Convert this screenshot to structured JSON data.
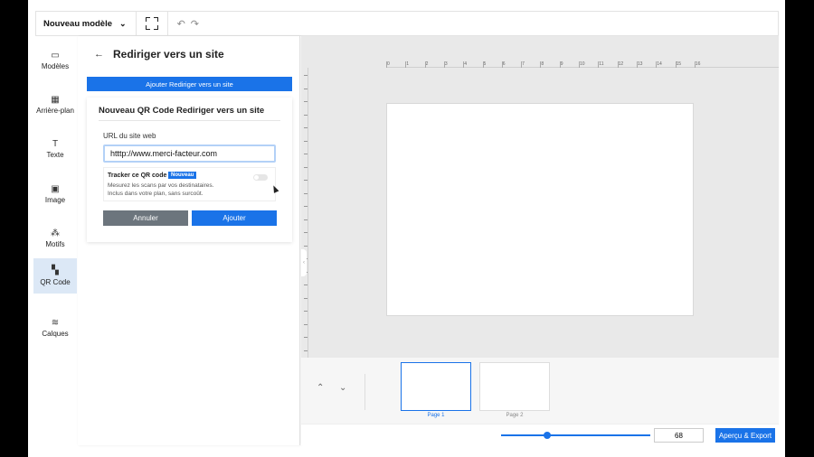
{
  "toolbar": {
    "model_label": "Nouveau modèle"
  },
  "sidebar": {
    "items": [
      {
        "key": "modeles",
        "label": "Modèles",
        "icon": "templates-icon",
        "glyph": "▭"
      },
      {
        "key": "arriere-plan",
        "label": "Arrière-plan",
        "icon": "background-icon",
        "glyph": "▦"
      },
      {
        "key": "texte",
        "label": "Texte",
        "icon": "text-icon",
        "glyph": "T"
      },
      {
        "key": "image",
        "label": "Image",
        "icon": "image-icon",
        "glyph": "▣"
      },
      {
        "key": "motifs",
        "label": "Motifs",
        "icon": "shapes-icon",
        "glyph": "⁂"
      },
      {
        "key": "qr-code",
        "label": "QR Code",
        "icon": "qr-code-icon",
        "glyph": "▚"
      },
      {
        "key": "calques",
        "label": "Calques",
        "icon": "layers-icon",
        "glyph": "≋"
      }
    ],
    "active": "qr-code"
  },
  "panel": {
    "title": "Rediriger vers un site",
    "add_bar": "Ajouter Rediriger vers un site",
    "card_title": "Nouveau QR Code Rediriger vers un site",
    "url_label": "URL du site web",
    "url_value": "htttp://www.merci-facteur.com",
    "tracker_title": "Tracker ce QR code",
    "tracker_badge": "Nouveau",
    "tracker_desc_1": "Mesurez les scans par vos destinataires.",
    "tracker_desc_2": "Inclus dans votre plan, sans surcoût.",
    "cancel": "Annuler",
    "add": "Ajouter"
  },
  "ruler": {
    "ticks": [
      "0",
      "1",
      "2",
      "3",
      "4",
      "5",
      "6",
      "7",
      "8",
      "9",
      "10",
      "11",
      "12",
      "13",
      "14",
      "15",
      "16"
    ]
  },
  "pages": [
    {
      "label": "Page 1",
      "active": true
    },
    {
      "label": "Page 2",
      "active": false
    }
  ],
  "zoom": {
    "value": "68",
    "slider_fraction": 0.31
  },
  "export_label": "Aperçu & Export",
  "colors": {
    "accent": "#1a73e8",
    "cancel": "#6c757d"
  }
}
